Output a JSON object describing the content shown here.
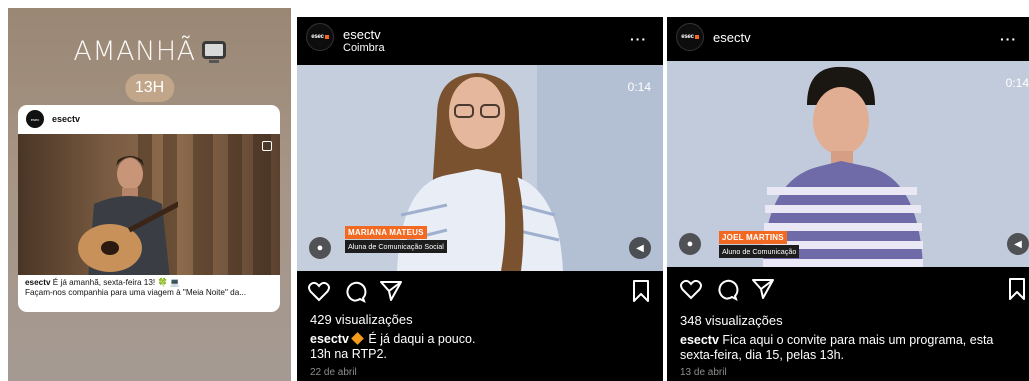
{
  "story": {
    "title": "AMANHÃ",
    "time_pill": "13H",
    "card": {
      "username": "esectv",
      "avatar_text": "esec",
      "caption_user": "esectv",
      "caption_text": " É já amanhã, sexta-feira 13! 🍀 💻",
      "caption_line2": "Façam-nos companhia para uma viagem à \"Meia Noite\" da..."
    }
  },
  "posts": [
    {
      "username": "esectv",
      "location": "Coimbra",
      "avatar_text": "esec",
      "timer": "0:14",
      "lower_third_name": "MARIANA MATEUS",
      "lower_third_role": "Aluna de Comunicação Social",
      "views": "429 visualizações",
      "caption_user": "esectv",
      "caption_text": " É já daqui a pouco.",
      "caption_line2": "13h na RTP2.",
      "date": "22 de abril"
    },
    {
      "username": "esectv",
      "location": "",
      "avatar_text": "esec",
      "timer": "0:14",
      "lower_third_name": "JOEL MARTINS",
      "lower_third_role": "Aluno de Comunicação",
      "views": "348 visualizações",
      "caption_user": "esectv",
      "caption_text": " Fica aqui o convite para mais um programa, esta sexta-feira, dia 15, pelas 13h.",
      "date": "13 de abril"
    }
  ],
  "colors": {
    "brand_orange": "#f26a21",
    "story_pill": "#c2a68a",
    "post_bg": "#000000",
    "date_grey": "#8e8e8e"
  },
  "icons": [
    "heart-icon",
    "comment-icon",
    "share-icon",
    "bookmark-icon",
    "more-icon",
    "user-tag-icon",
    "sound-icon",
    "multi-image-icon",
    "tv-icon"
  ]
}
